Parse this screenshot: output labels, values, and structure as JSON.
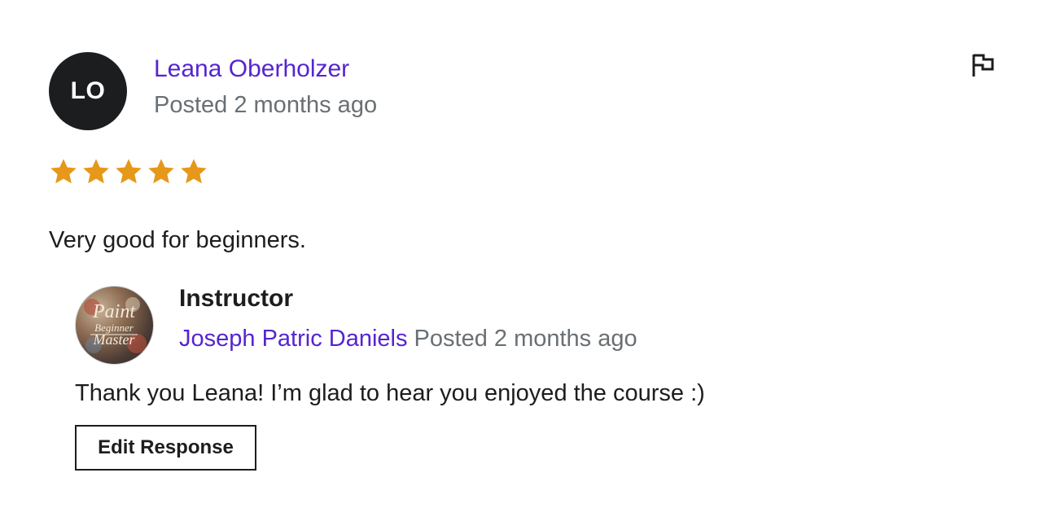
{
  "review": {
    "avatar_initials": "LO",
    "reviewer_name": "Leana Oberholzer",
    "posted": "Posted 2 months ago",
    "rating": 5,
    "rating_max": 5,
    "comment": "Very good for beginners.",
    "star_color": "#e59819"
  },
  "response": {
    "role": "Instructor",
    "avatar_logo_lines": [
      "Paint",
      "Beginner",
      "Master"
    ],
    "instructor_name": "Joseph Patric Daniels",
    "posted": "Posted 2 months ago",
    "text": "Thank you Leana! I’m glad to hear you enjoyed the course :)",
    "edit_button_label": "Edit Response"
  },
  "icons": {
    "flag": "flag-icon",
    "star": "star-icon"
  },
  "colors": {
    "link": "#5624d0",
    "muted": "#6a6f73",
    "text": "#1c1d1f"
  }
}
